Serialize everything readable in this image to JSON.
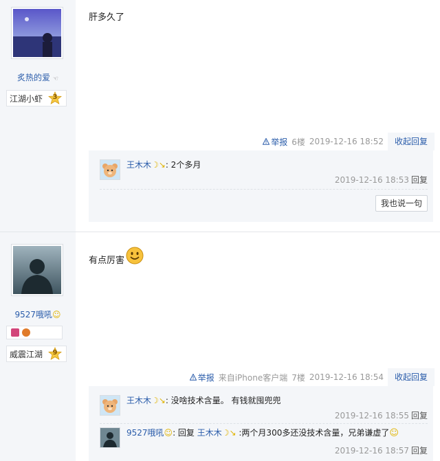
{
  "post1": {
    "username": "炙热的爱",
    "rank": "江湖小虾",
    "level": "3",
    "content": "肝多久了",
    "report": "举报",
    "floor": "6楼",
    "time": "2019-12-16 18:52",
    "collapse": "收起回复",
    "replies": [
      {
        "user": "王木木",
        "text": ": 2个多月",
        "time": "2019-12-16 18:53",
        "reply_label": "回复"
      }
    ],
    "say_button": "我也说一句"
  },
  "post2": {
    "username": "9527哦吼",
    "rank": "威震江湖",
    "level": "9",
    "content": "有点厉害",
    "report": "举报",
    "source": "来自iPhone客户端",
    "floor": "7楼",
    "time": "2019-12-16 18:54",
    "collapse": "收起回复",
    "replies": [
      {
        "user": "王木木",
        "text": ": 没啥技术含量。 有钱就囤兜兜",
        "time": "2019-12-16 18:55",
        "reply_label": "回复"
      },
      {
        "user": "9527哦吼",
        "pre": ": 回复 ",
        "target": "王木木",
        "text": " :两个月300多还没技术含量，兄弟谦虚了",
        "time": "2019-12-16 18:57",
        "reply_label": "回复"
      }
    ]
  }
}
